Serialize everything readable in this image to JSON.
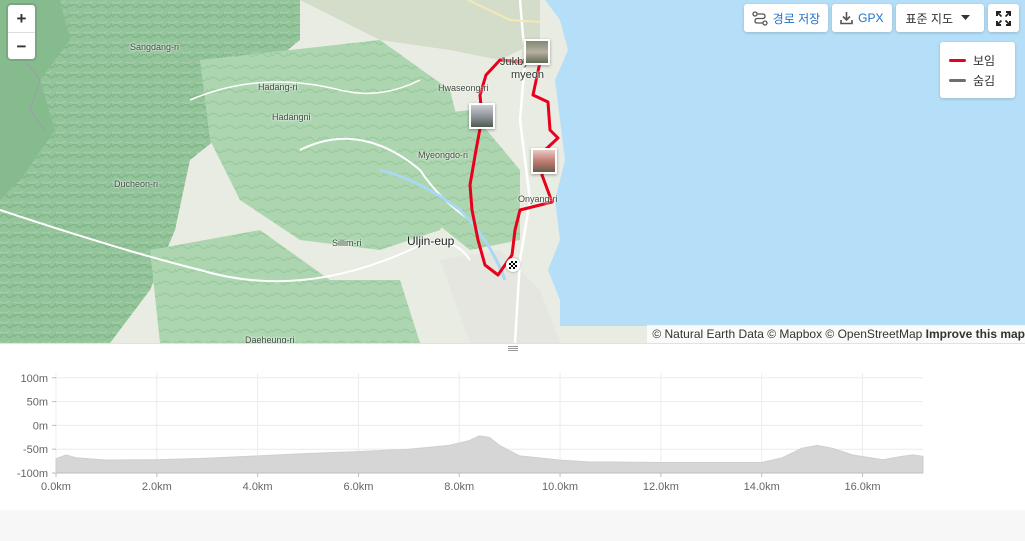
{
  "map": {
    "zoom_in": "+",
    "zoom_out": "−",
    "places": [
      {
        "name": "Sangdang-ri",
        "cls": ""
      },
      {
        "name": "Hadang-ri",
        "cls": ""
      },
      {
        "name": "Hadangni",
        "cls": ""
      },
      {
        "name": "Ducheon-ri",
        "cls": ""
      },
      {
        "name": "Hwaseong-ri",
        "cls": ""
      },
      {
        "name": "Myeongdo-ri",
        "cls": ""
      },
      {
        "name": "Onyang-ri",
        "cls": ""
      },
      {
        "name": "Sillim-ri",
        "cls": ""
      },
      {
        "name": "Uljin-eup",
        "cls": "big"
      },
      {
        "name": "Jukbyeon-",
        "cls": "mid"
      },
      {
        "name": "myeon",
        "cls": "mid"
      },
      {
        "name": "Daeheung-ri",
        "cls": ""
      }
    ],
    "toolbar": {
      "save_route": "경로 저장",
      "gpx": "GPX",
      "map_style": "표준 지도"
    },
    "legend": [
      {
        "label": "보임",
        "color": "#e8001c"
      },
      {
        "label": "숨김",
        "color": "#6d6d78"
      }
    ],
    "attribution": {
      "text": "© Natural Earth Data © Mapbox © OpenStreetMap ",
      "improve": "Improve this map"
    }
  },
  "chart_data": {
    "type": "area",
    "title": "",
    "xlabel": "",
    "ylabel": "",
    "xlim": [
      0,
      17.2
    ],
    "ylim": [
      -100,
      110
    ],
    "y_ticks": [
      "100m",
      "50m",
      "0m",
      "-50m",
      "-100m"
    ],
    "y_tick_values": [
      100,
      50,
      0,
      -50,
      -100
    ],
    "x_ticks": [
      "0.0km",
      "2.0km",
      "4.0km",
      "6.0km",
      "8.0km",
      "10.0km",
      "12.0km",
      "14.0km",
      "16.0km"
    ],
    "x_tick_values": [
      0,
      2,
      4,
      6,
      8,
      10,
      12,
      14,
      16
    ],
    "grid": true,
    "series": [
      {
        "fill": "#d6d6d6",
        "x": [
          0,
          0.2,
          0.4,
          1,
          2,
          3,
          4,
          5,
          6,
          7,
          7.8,
          8.2,
          8.4,
          8.6,
          8.8,
          9.2,
          10,
          10.6,
          11,
          12,
          13,
          14,
          14.4,
          14.8,
          15.1,
          15.4,
          15.8,
          16.4,
          16.8,
          17.0,
          17.2
        ],
        "y": [
          -70,
          -62,
          -68,
          -73,
          -72,
          -69,
          -64,
          -59,
          -55,
          -50,
          -42,
          -32,
          -22,
          -25,
          -42,
          -64,
          -73,
          -77,
          -77,
          -78,
          -78,
          -78,
          -68,
          -48,
          -42,
          -48,
          -62,
          -72,
          -65,
          -62,
          -65
        ]
      }
    ]
  }
}
